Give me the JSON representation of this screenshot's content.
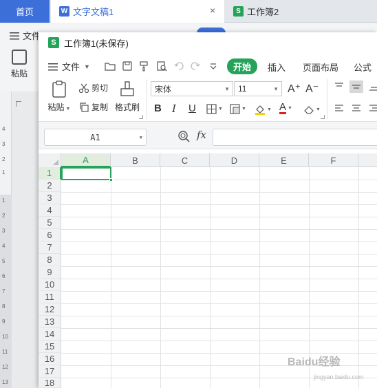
{
  "tabs": {
    "home": "首页",
    "doc_tab": "文字文稿1",
    "doc_badge": "W",
    "sheet_tab": "工作簿2",
    "sheet_badge": "S",
    "close": "×"
  },
  "background_doc": {
    "file_menu": "文件",
    "paste": "粘贴",
    "ruler_numbers": [
      "4",
      "3",
      "2",
      "1",
      "1",
      "2",
      "3",
      "4",
      "5",
      "6",
      "7",
      "8",
      "9",
      "10",
      "11",
      "12",
      "13"
    ]
  },
  "window": {
    "badge": "S",
    "title": "工作簿1(未保存)"
  },
  "menu": {
    "file": "文件",
    "tabs": [
      "开始",
      "插入",
      "页面布局",
      "公式"
    ]
  },
  "ribbon": {
    "paste": "粘贴",
    "cut": "剪切",
    "copy": "复制",
    "format_painter": "格式刷",
    "font_name": "宋体",
    "font_size": "11",
    "increase_font": "A⁺",
    "decrease_font": "A⁻",
    "bold": "B",
    "italic": "I",
    "underline": "U"
  },
  "formula_bar": {
    "name_box": "A1",
    "fx": "fx",
    "formula": ""
  },
  "grid": {
    "columns": [
      "A",
      "B",
      "C",
      "D",
      "E",
      "F"
    ],
    "rows": [
      "1",
      "2",
      "3",
      "4",
      "5",
      "6",
      "7",
      "8",
      "9",
      "10",
      "11",
      "12",
      "13",
      "14",
      "15",
      "16",
      "17",
      "18"
    ],
    "selected_cell": "A1"
  },
  "watermark": {
    "text": "Baidu经验",
    "sub": "jingyan.baidu.com"
  },
  "colors": {
    "brand_green": "#25a35a",
    "home_blue": "#3c6fd8"
  }
}
